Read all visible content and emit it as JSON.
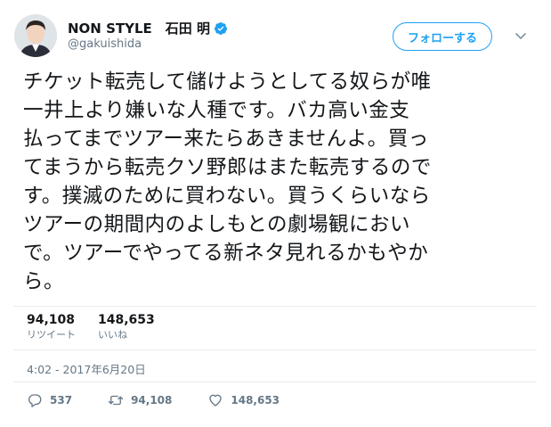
{
  "user": {
    "display_name": "NON STYLE　石田 明",
    "handle": "@gakuishida",
    "verified": true
  },
  "follow_button": {
    "label": "フォローする"
  },
  "tweet": {
    "text": "チケット転売して儲けようとしてる奴らが唯\n一井上より嫌いな人種です。バカ高い金支\n払ってまでツアー来たらあきませんよ。買っ\nてまうから転売クソ野郎はまた転売するので\nす。撲滅のために買わない。買うくらいなら\nツアーの期間内のよしもとの劇場観におい\nで。ツアーでやってる新ネタ見れるかもやか\nら。"
  },
  "stats": {
    "retweets": "94,108",
    "retweets_label": "リツイート",
    "likes": "148,653",
    "likes_label": "いいね"
  },
  "timestamp": "4:02 - 2017年6月20日",
  "actions": {
    "replies": "537",
    "retweets": "94,108",
    "likes": "148,653"
  },
  "colors": {
    "accent": "#1da1f2",
    "secondary_text": "#657786",
    "primary_text": "#14171a"
  }
}
